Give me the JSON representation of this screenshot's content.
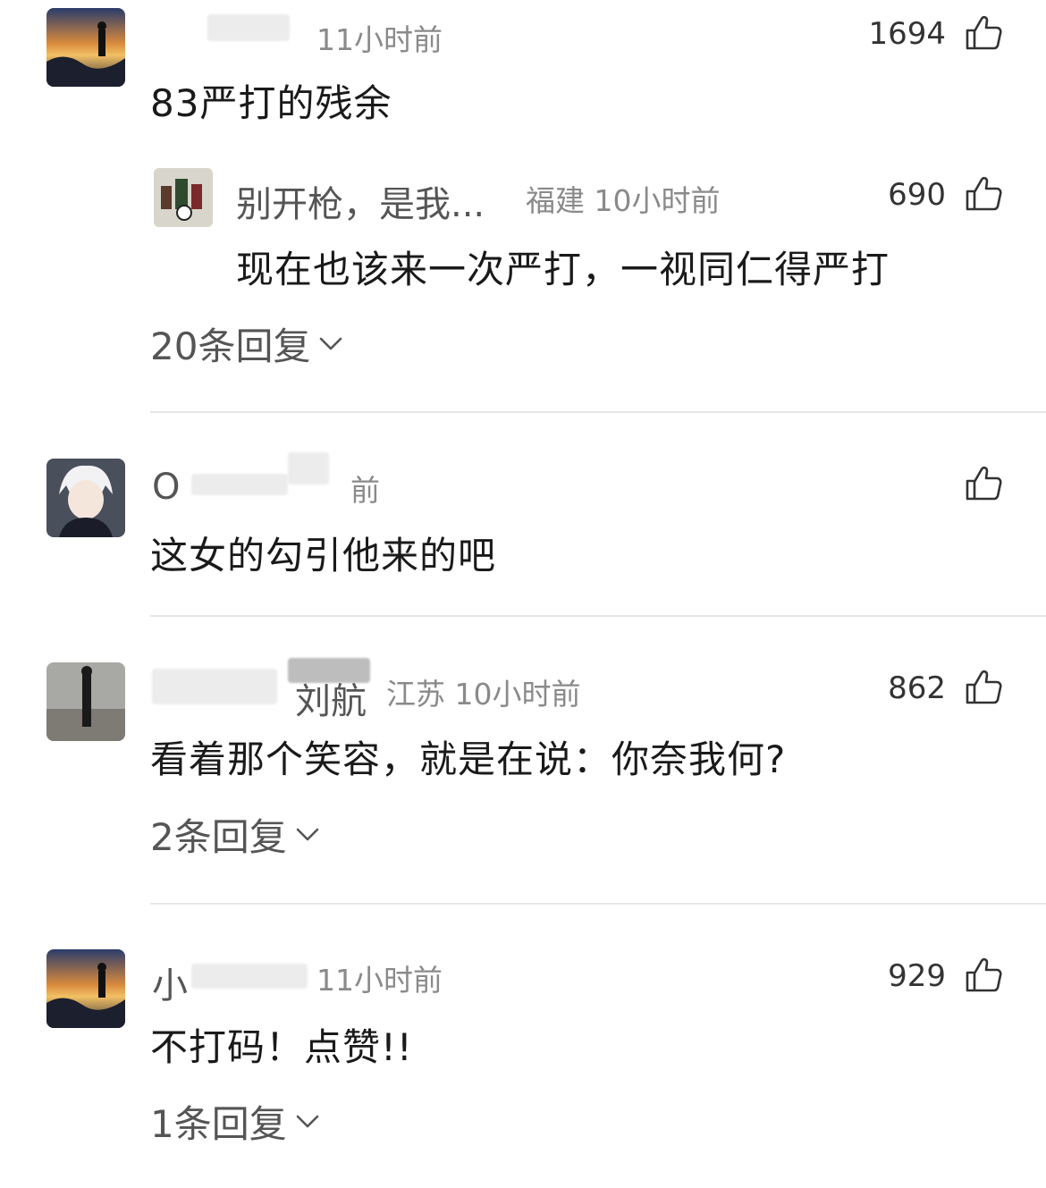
{
  "comments": [
    {
      "meta": "11小时前",
      "likes": "1694",
      "text": "83严打的残余",
      "reply": {
        "nickname": "别开枪，是我...",
        "meta": "福建 10小时前",
        "likes": "690",
        "text": "现在也该来一次严打，一视同仁得严打"
      },
      "replies_label": "20条回复"
    },
    {
      "nickname": "O",
      "meta": "前",
      "likes": "",
      "text": "这女的勾引他来的吧"
    },
    {
      "nickname": "刘航",
      "meta": "江苏 10小时前",
      "likes": "862",
      "text": "看着那个笑容，就是在说：你奈我何?",
      "replies_label": "2条回复"
    },
    {
      "nickname": "小",
      "meta": "11小时前",
      "likes": "929",
      "text": "不打码！点赞!!",
      "replies_label": "1条回复"
    }
  ],
  "icons": {
    "like": "thumbs-up-icon",
    "expand": "chevron-down-icon"
  }
}
